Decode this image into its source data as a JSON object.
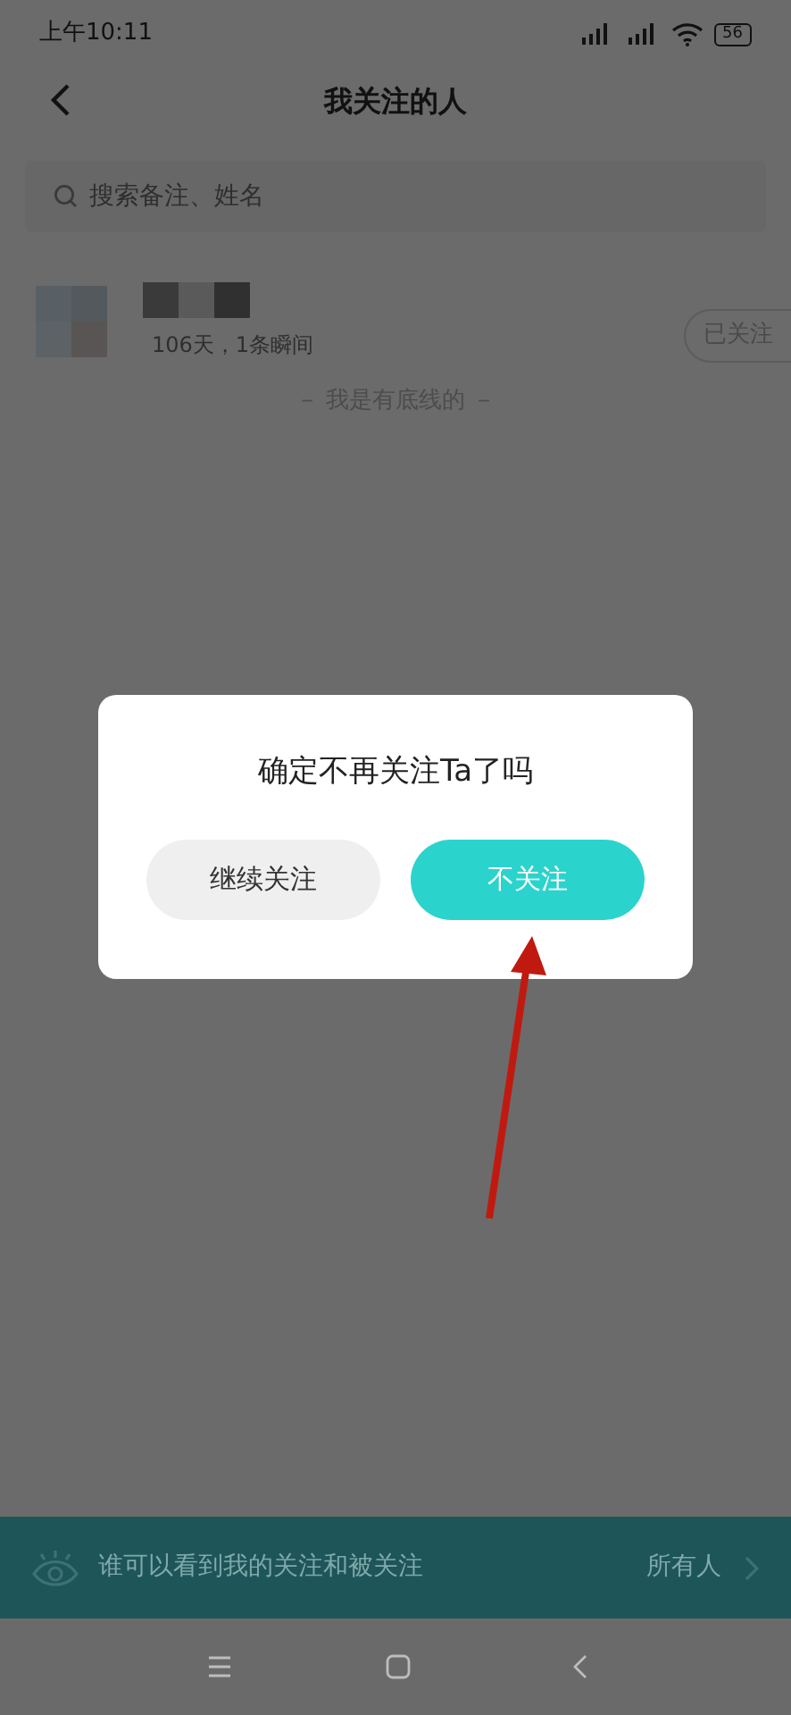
{
  "status_bar": {
    "time": "上午10:11",
    "battery": "56"
  },
  "nav": {
    "title": "我关注的人"
  },
  "search": {
    "placeholder": "搜索备注、姓名"
  },
  "follows": [
    {
      "subtitle": "106天，1条瞬间",
      "button": "已关注"
    }
  ],
  "end_note": "－ 我是有底线的 －",
  "dialog": {
    "title": "确定不再关注Ta了吗",
    "buttons": [
      {
        "label": "继续关注",
        "kind": "secondary"
      },
      {
        "label": "不关注",
        "kind": "primary"
      }
    ]
  },
  "privacy": {
    "label": "谁可以看到我的关注和被关注",
    "value": "所有人"
  }
}
